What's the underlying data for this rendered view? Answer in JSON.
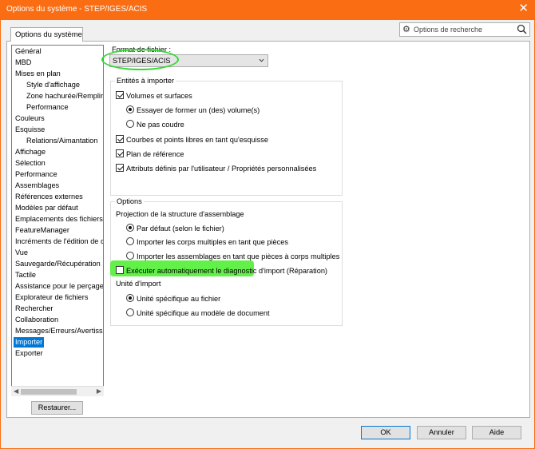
{
  "window": {
    "title": "Options du système - STEP/IGES/ACIS",
    "close_glyph": "✕"
  },
  "tab": {
    "label": "Options du système"
  },
  "search": {
    "placeholder": "Options de recherche"
  },
  "tree": {
    "items": [
      {
        "label": "Général",
        "indent": 0
      },
      {
        "label": "MBD",
        "indent": 0
      },
      {
        "label": "Mises en plan",
        "indent": 0
      },
      {
        "label": "Style d'affichage",
        "indent": 1
      },
      {
        "label": "Zone hachurée/Remplir",
        "indent": 1
      },
      {
        "label": "Performance",
        "indent": 1
      },
      {
        "label": "Couleurs",
        "indent": 0
      },
      {
        "label": "Esquisse",
        "indent": 0
      },
      {
        "label": "Relations/Aimantation",
        "indent": 1
      },
      {
        "label": "Affichage",
        "indent": 0
      },
      {
        "label": "Sélection",
        "indent": 0
      },
      {
        "label": "Performance",
        "indent": 0
      },
      {
        "label": "Assemblages",
        "indent": 0
      },
      {
        "label": "Références externes",
        "indent": 0
      },
      {
        "label": "Modèles par défaut",
        "indent": 0
      },
      {
        "label": "Emplacements des fichiers",
        "indent": 0
      },
      {
        "label": "FeatureManager",
        "indent": 0
      },
      {
        "label": "Incréments de l'édition de c",
        "indent": 0
      },
      {
        "label": "Vue",
        "indent": 0
      },
      {
        "label": "Sauvegarde/Récupération",
        "indent": 0
      },
      {
        "label": "Tactile",
        "indent": 0
      },
      {
        "label": "Assistance pour le perçage/",
        "indent": 0
      },
      {
        "label": "Explorateur de fichiers",
        "indent": 0
      },
      {
        "label": "Rechercher",
        "indent": 0
      },
      {
        "label": "Collaboration",
        "indent": 0
      },
      {
        "label": "Messages/Erreurs/Avertisse",
        "indent": 0
      },
      {
        "label": "Importer",
        "indent": 0,
        "selected": true
      },
      {
        "label": "Exporter",
        "indent": 0
      }
    ]
  },
  "restore_button": "Restaurer...",
  "format": {
    "label": "Format de fichier :",
    "value": "STEP/IGES/ACIS"
  },
  "entities": {
    "legend": "Entités à importer",
    "volumes": "Volumes et surfaces",
    "try_form": "Essayer de former un (des) volume(s)",
    "no_sew": "Ne pas coudre",
    "curves": "Courbes et points libres en tant qu'esquisse",
    "ref_plane": "Plan de référence",
    "attributes": "Attributs définis par l'utilisateur / Propriétés personnalisées"
  },
  "options": {
    "legend": "Options",
    "projection_label": "Projection de la structure d'assemblage",
    "default_file": "Par défaut (selon le fichier)",
    "multi_bodies_parts": "Importer les corps multiples en tant que pièces",
    "assemblies_multibody": "Importer les assemblages en tant que pièces à corps multiples",
    "diagnostic": "Exécuter automatiquement le diagnostic d'import (Réparation)",
    "unit_label": "Unité d'import",
    "unit_file": "Unité spécifique au fichier",
    "unit_template": "Unité spécifique au modèle de document"
  },
  "footer": {
    "ok": "OK",
    "cancel": "Annuler",
    "help": "Aide"
  },
  "colors": {
    "titlebar": "#fb6d12",
    "selection": "#0078d7",
    "highlight_green": "#46ee28"
  }
}
